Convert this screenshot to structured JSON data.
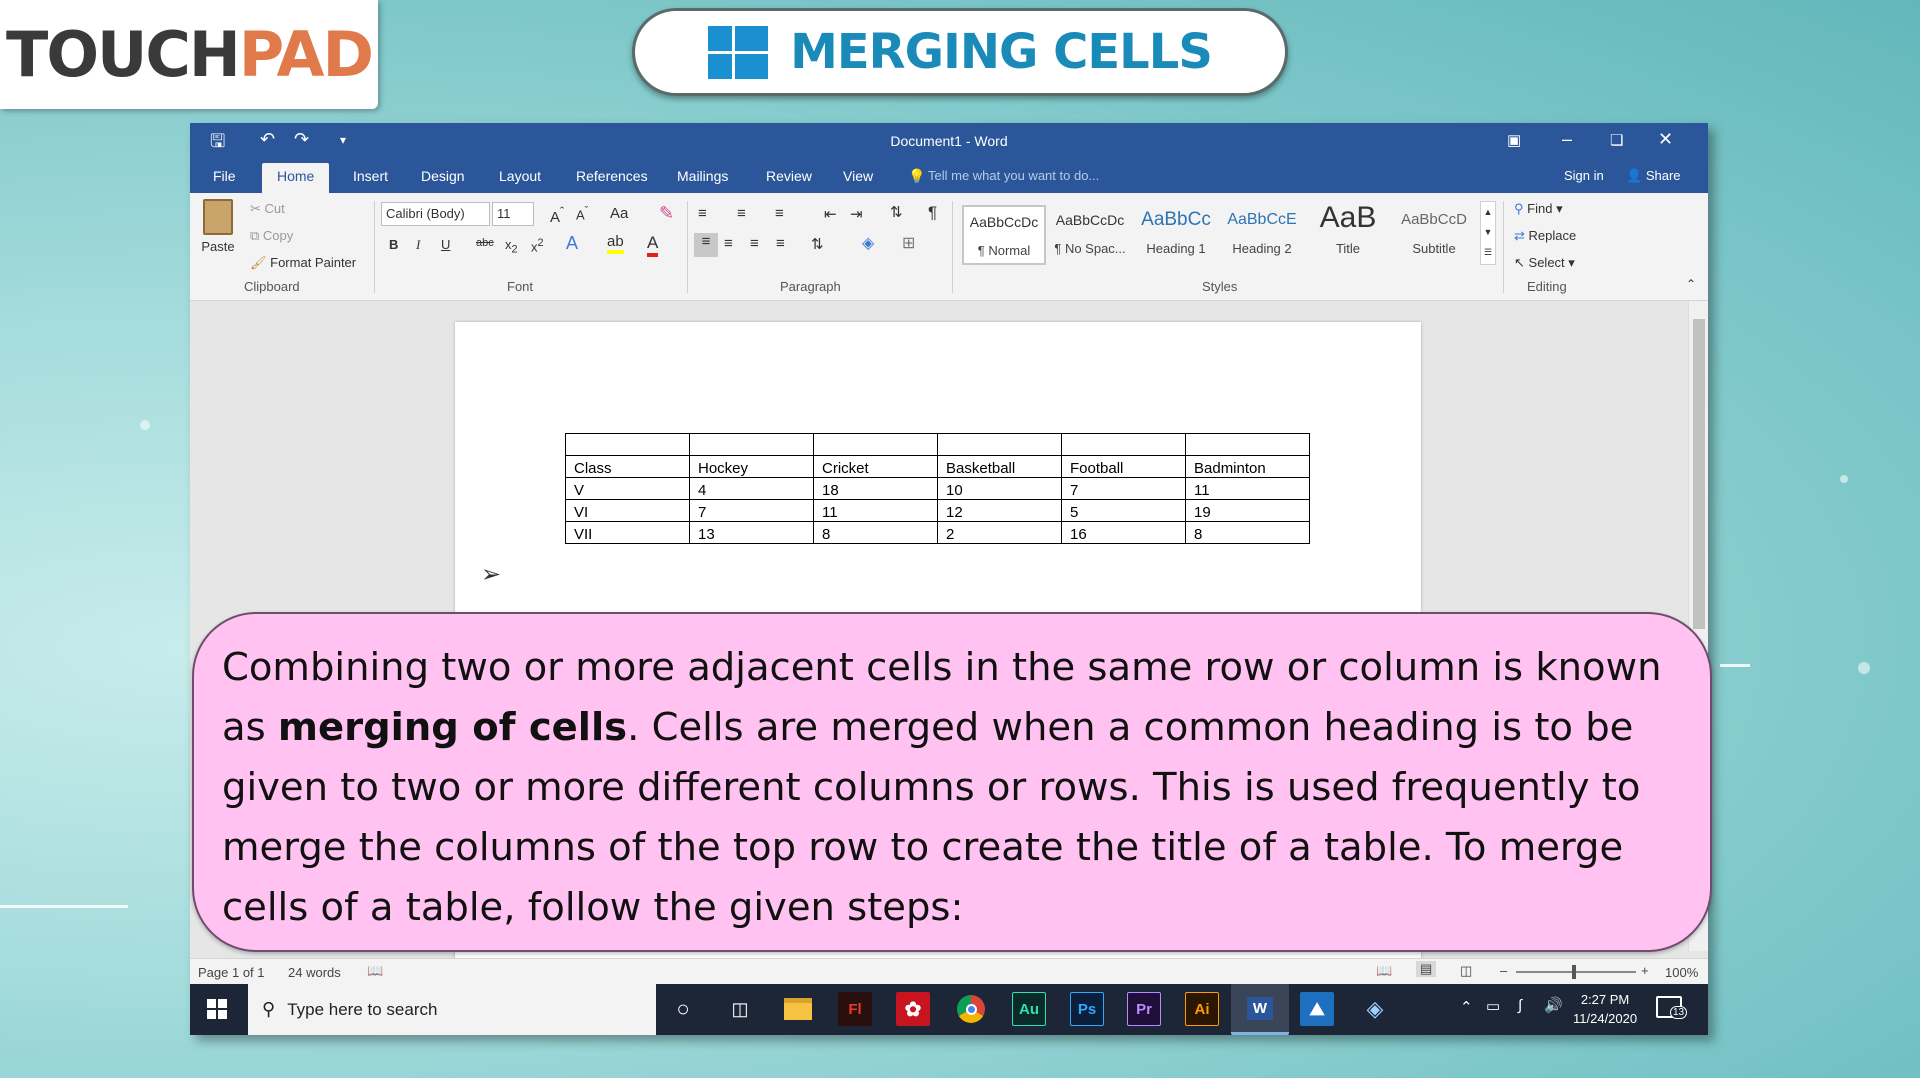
{
  "brand": {
    "logo_part1": "TOUCH",
    "logo_part2": "PAD"
  },
  "slide": {
    "title": "MERGING CELLS"
  },
  "window": {
    "title": "Document1 - Word"
  },
  "ribbon": {
    "tabs": [
      "File",
      "Home",
      "Insert",
      "Design",
      "Layout",
      "References",
      "Mailings",
      "Review",
      "View"
    ],
    "active_tab": "Home",
    "tell_me": "Tell me what you want to do...",
    "sign_in": "Sign in",
    "share": "Share",
    "clipboard": {
      "paste": "Paste",
      "cut": "Cut",
      "copy": "Copy",
      "format_painter": "Format Painter",
      "label": "Clipboard"
    },
    "font": {
      "name": "Calibri (Body)",
      "size": "11",
      "label": "Font",
      "change_case": "Aa"
    },
    "paragraph": {
      "label": "Paragraph"
    },
    "styles": {
      "label": "Styles",
      "items": [
        {
          "preview": "AaBbCcDc",
          "name": "¶ Normal"
        },
        {
          "preview": "AaBbCcDc",
          "name": "¶ No Spac..."
        },
        {
          "preview": "AaBbCc",
          "name": "Heading 1"
        },
        {
          "preview": "AaBbCcE",
          "name": "Heading 2"
        },
        {
          "preview": "AaB",
          "name": "Title"
        },
        {
          "preview": "AaBbCcD",
          "name": "Subtitle"
        }
      ]
    },
    "editing": {
      "find": "Find",
      "replace": "Replace",
      "select": "Select",
      "label": "Editing"
    }
  },
  "document": {
    "table": {
      "headers": [
        "Class",
        "Hockey",
        "Cricket",
        "Basketball",
        "Football",
        "Badminton"
      ],
      "rows": [
        [
          "V",
          "4",
          "18",
          "10",
          "7",
          "11"
        ],
        [
          "VI",
          "7",
          "11",
          "12",
          "5",
          "19"
        ],
        [
          "VII",
          "13",
          "8",
          "2",
          "16",
          "8"
        ]
      ]
    }
  },
  "statusbar": {
    "page": "Page 1 of 1",
    "words": "24 words",
    "zoom": "100%"
  },
  "taskbar": {
    "search_placeholder": "Type here to search",
    "time": "2:27 PM",
    "date": "11/24/2020",
    "notifications": "13",
    "apps": [
      {
        "label": "Fl",
        "color": "#2a0f0f",
        "fg": "#e8392b"
      },
      {
        "label": "",
        "color": "#c8141e",
        "fg": "#ffffff"
      },
      {
        "label": "",
        "color": "#ffffff",
        "fg": "#ffffff"
      },
      {
        "label": "Au",
        "color": "#0b2b28",
        "fg": "#2fe0b2"
      },
      {
        "label": "Ps",
        "color": "#0b1f3a",
        "fg": "#31a8ff"
      },
      {
        "label": "Pr",
        "color": "#1f0f3a",
        "fg": "#b68cff"
      },
      {
        "label": "Ai",
        "color": "#2b1600",
        "fg": "#ff9a00"
      },
      {
        "label": "W",
        "color": "#2b579a",
        "fg": "#ffffff"
      },
      {
        "label": "",
        "color": "#1e6fc0",
        "fg": "#ffffff"
      },
      {
        "label": "",
        "color": "#3a6fa8",
        "fg": "#ffffff"
      }
    ]
  },
  "caption": {
    "part1": "Combining two or more adjacent cells in the same row or column is known as",
    "bold": "merging of cells",
    "part2": ". Cells are merged when a common heading is to be given to two or more different columns or rows. This is used frequently to merge the columns of the top row to create the title of a table. To merge cells of a table, follow the given steps:"
  }
}
